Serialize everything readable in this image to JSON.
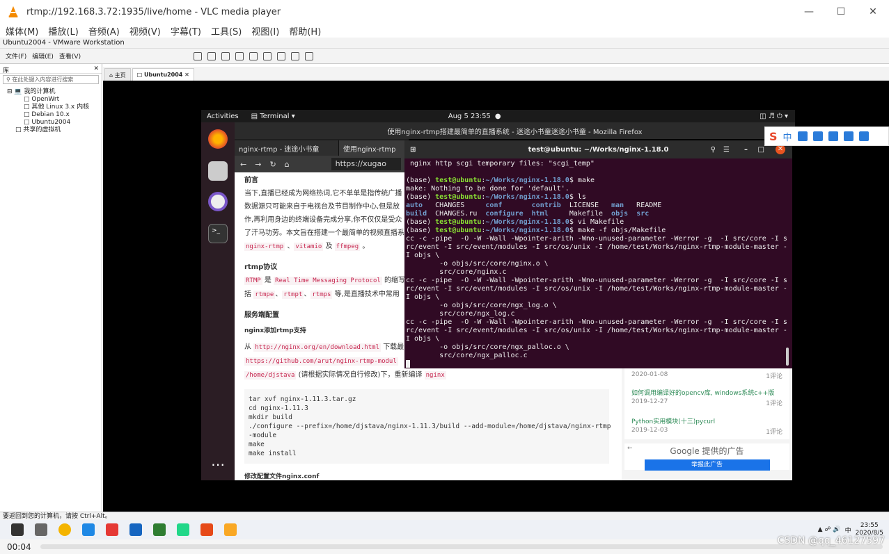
{
  "vlc": {
    "title": "rtmp://192.168.3.72:1935/live/home - VLC media player",
    "menu": [
      "媒体(M)",
      "播放(L)",
      "音频(A)",
      "视频(V)",
      "字幕(T)",
      "工具(S)",
      "视图(I)",
      "帮助(H)"
    ],
    "time": "00:04"
  },
  "vmware": {
    "title": "Ubuntu2004 - VMware Workstation",
    "menu": [
      "文件(F)",
      "编辑(E)",
      "查看(V)"
    ],
    "library_title": "库",
    "search_placeholder": "在此处键入内容进行搜索",
    "tree": [
      "我的计算机",
      "OpenWrt",
      "其他 Linux 3.x 内核",
      "Debian 10.x",
      "Ubuntu2004",
      "共享的虚拟机"
    ],
    "tabs": [
      "主页",
      "Ubuntu2004"
    ],
    "status": "要返回到您的计算机，请按 Ctrl+Alt。"
  },
  "ubuntu": {
    "activities": "Activities",
    "app": "Terminal",
    "clock": "Aug 5  23:55"
  },
  "firefox": {
    "window_title": "使用nginx-rtmp搭建最简单的直播系统 - 迷途小书童迷途小书童 - Mozilla Firefox",
    "tabs": [
      "nginx-rtmp - 迷途小书童",
      "使用nginx-rtmp"
    ],
    "url": "https://xugao"
  },
  "article": {
    "h_intro": "前言",
    "p1_lines": [
      "当下,直播已经成为网络热词,它不单单是指传统广播",
      "数据源只可能来自于电视台及节目制作中心,但是放",
      "作,再利用身边的终端设备完成分享,你不仅仅是受众",
      "了汗马功劳。本文旨在搭建一个最简单的视频直播系"
    ],
    "tags1": [
      "nginx-rtmp",
      "vitamio",
      "ffmpeg"
    ],
    "h_rtmp": "rtmp协议",
    "rtmp_line1_a": "RTMP",
    "rtmp_line1_b": "是",
    "rtmp_line1_c": "Real Time Messaging Protocol",
    "rtmp_line1_d": "的缩写",
    "rtmp_line2_a": "括",
    "rtmp_tags": [
      "rtmpe",
      "rtmpt",
      "rtmps"
    ],
    "rtmp_line2_b": "等,是直播技术中常用",
    "h_server": "服务端配置",
    "h_nginx": "nginx添加rtmp支持",
    "from": "从",
    "url1": "http://nginx.org/en/download.html",
    "download": "下载最",
    "url2": "https://github.com/arut/nginx-rtmp-modul",
    "path": "/home/djstava",
    "recompile": "(请根据实际情况自行修改)下，重新编译",
    "nginx_tag": "nginx",
    "code": "tar xvf nginx-1.11.3.tar.gz\ncd nginx-1.11.3\nmkdir build\n./configure --prefix=/home/djstava/nginx-1.11.3/build --add-module=/home/djstava/nginx-rtmp\n-module\nmake\nmake install",
    "h_conf": "修改配置文件nginx.conf"
  },
  "sidebar": {
    "items": [
      {
        "title": "",
        "date": "2020-01-08",
        "comments": "1评论"
      },
      {
        "title": "如何调用编译好的opencv库, windows系统c++版",
        "date": "2019-12-27",
        "comments": "1评论"
      },
      {
        "title": "Python实用模块(十三)pycurl",
        "date": "2019-12-03",
        "comments": "1评论"
      }
    ],
    "ad_label": "Google 提供的广告",
    "ad_button": "举报此广告"
  },
  "terminal": {
    "title": "test@ubuntu: ~/Works/nginx-1.18.0",
    "lines": [
      " nginx http scgi temporary files: \"scgi_temp\"",
      "",
      "(base) [P]test@ubuntu[/P]:[D]~/Works/nginx-1.18.0[/D]$ make",
      "make: Nothing to be done for 'default'.",
      "(base) [P]test@ubuntu[/P]:[D]~/Works/nginx-1.18.0[/D]$ ls",
      "[D]auto[/D]   CHANGES     [D]conf[/D]       [D]contrib[/D]  LICENSE   [D]man[/D]   README",
      "[D]build[/D]  CHANGES.ru  [D]configure[/D]  [D]html[/D]     Makefile  [D]objs[/D]  [D]src[/D]",
      "(base) [P]test@ubuntu[/P]:[D]~/Works/nginx-1.18.0[/D]$ vi Makefile",
      "(base) [P]test@ubuntu[/P]:[D]~/Works/nginx-1.18.0[/D]$ make -f objs/Makefile",
      "cc -c -pipe  -O -W -Wall -Wpointer-arith -Wno-unused-parameter -Werror -g  -I src/core -I s",
      "rc/event -I src/event/modules -I src/os/unix -I /home/test/Works/nginx-rtmp-module-master -",
      "I objs \\",
      "        -o objs/src/core/nginx.o \\",
      "        src/core/nginx.c",
      "cc -c -pipe  -O -W -Wall -Wpointer-arith -Wno-unused-parameter -Werror -g  -I src/core -I s",
      "rc/event -I src/event/modules -I src/os/unix -I /home/test/Works/nginx-rtmp-module-master -",
      "I objs \\",
      "        -o objs/src/core/ngx_log.o \\",
      "        src/core/ngx_log.c",
      "cc -c -pipe  -O -W -Wall -Wpointer-arith -Wno-unused-parameter -Werror -g  -I src/core -I s",
      "rc/event -I src/event/modules -I src/os/unix -I /home/test/Works/nginx-rtmp-module-master -",
      "I objs \\",
      "        -o objs/src/core/ngx_palloc.o \\",
      "        src/core/ngx_palloc.c"
    ]
  },
  "taskbar": {
    "tray_time": "23:55",
    "tray_date": "2020/8/5",
    "ime": "中",
    "watermark": "CSDN @qq_46127597"
  },
  "colors": {
    "vlc_orange": "#f48a00",
    "terminal_bg": "#300a24",
    "ubuntu_dock": "#2b1d24",
    "link_green": "#2e8b57"
  }
}
